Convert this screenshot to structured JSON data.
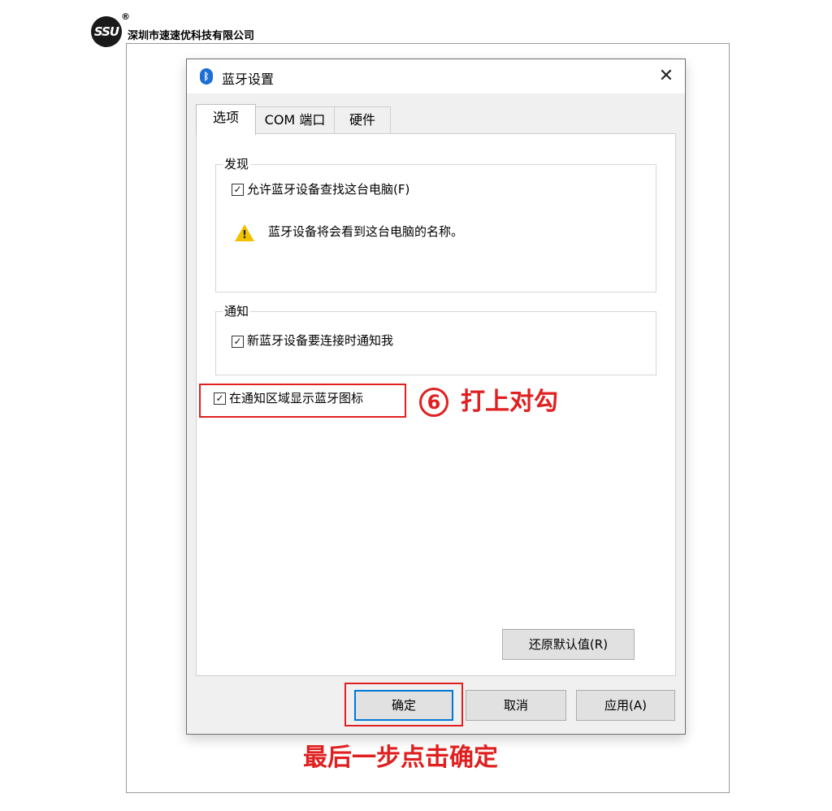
{
  "header": {
    "logo_text": "SSU",
    "registered_mark": "®",
    "company_name": "深圳市速速优科技有限公司"
  },
  "dialog": {
    "title": "蓝牙设置",
    "close_glyph": "✕",
    "tabs": [
      {
        "label": "选项",
        "active": true
      },
      {
        "label": "COM 端口",
        "active": false
      },
      {
        "label": "硬件",
        "active": false
      }
    ],
    "discovery": {
      "title": "发现",
      "allow_discovery_label": "允许蓝牙设备查找这台电脑(F)",
      "allow_discovery_checked": true,
      "warning_text": "蓝牙设备将会看到这台电脑的名称。"
    },
    "notification": {
      "title": "通知",
      "notify_label": "新蓝牙设备要连接时通知我",
      "notify_checked": true
    },
    "show_icon_label": "在通知区域显示蓝牙图标",
    "show_icon_checked": true,
    "restore_defaults_label": "还原默认值(R)",
    "ok_label": "确定",
    "cancel_label": "取消",
    "apply_label": "应用(A)"
  },
  "annotations": {
    "step_number": "6",
    "step_text": "打上对勾",
    "final_text": "最后一步点击确定",
    "color": "#e02020"
  },
  "icons": {
    "bluetooth": "bluetooth-icon",
    "warning": "warning-icon",
    "check": "✓"
  }
}
